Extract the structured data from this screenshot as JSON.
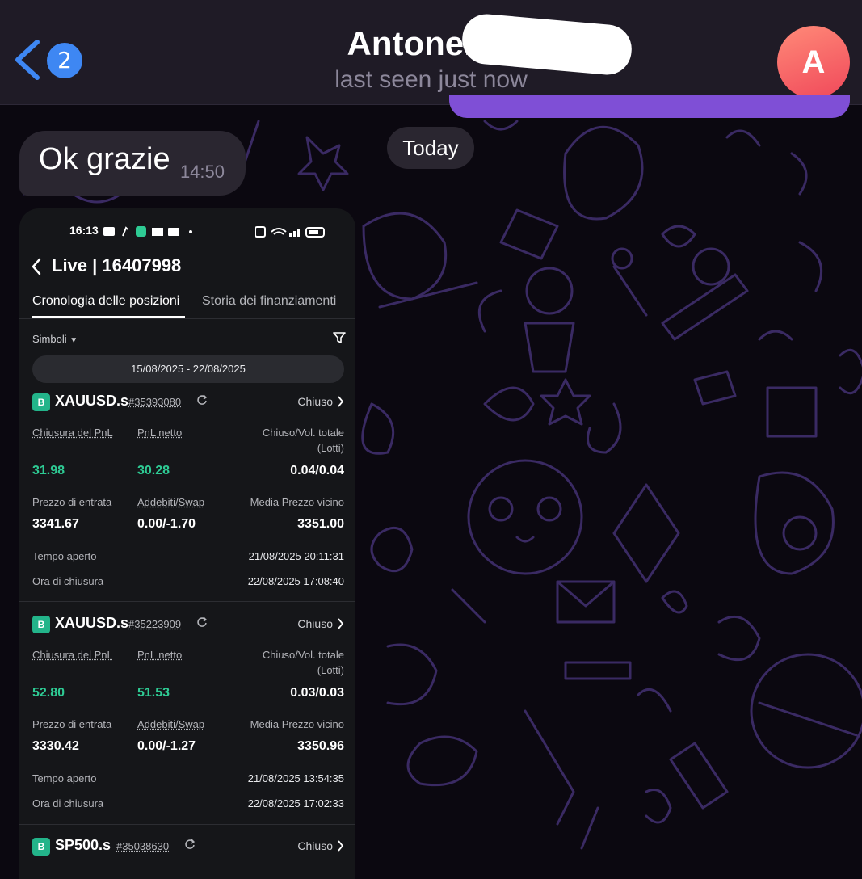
{
  "header": {
    "back_badge": "2",
    "contact_name": "Antonella M",
    "status": "last seen just now",
    "avatar_letter": "A"
  },
  "chat": {
    "date_chip": "Today",
    "message": {
      "text": "Ok grazie",
      "time": "14:50"
    }
  },
  "screenshot": {
    "statusbar": {
      "time": "16:13"
    },
    "title": "Live | 16407998",
    "tabs": [
      "Cronologia delle posizioni",
      "Storia dei finanziamenti"
    ],
    "filter_label": "Simboli",
    "date_range": "15/08/2025 - 22/08/2025",
    "labels": {
      "closing_pnl": "Chiusura del PnL",
      "net_pnl": "PnL netto",
      "closed_volume": "Chiuso/Vol. totale",
      "lots": "(Lotti)",
      "entry_price": "Prezzo di entrata",
      "charges_swap": "Addebiti/Swap",
      "avg_close_price": "Media Prezzo vicino",
      "open_time": "Tempo aperto",
      "close_time": "Ora di chiusura"
    },
    "positions": [
      {
        "side": "B",
        "symbol": "XAUUSD.s",
        "id": "#35393080",
        "status": "Chiuso",
        "closing_pnl": "31.98",
        "net_pnl": "30.28",
        "volume": "0.04/0.04",
        "entry_price": "3341.67",
        "charges_swap": "0.00/-1.70",
        "avg_close": "3351.00",
        "open_time": "21/08/2025 20:11:31",
        "close_time": "22/08/2025 17:08:40"
      },
      {
        "side": "B",
        "symbol": "XAUUSD.s",
        "id": "#35223909",
        "status": "Chiuso",
        "closing_pnl": "52.80",
        "net_pnl": "51.53",
        "volume": "0.03/0.03",
        "entry_price": "3330.42",
        "charges_swap": "0.00/-1.27",
        "avg_close": "3350.96",
        "open_time": "21/08/2025 13:54:35",
        "close_time": "22/08/2025 17:02:33"
      },
      {
        "side": "B",
        "symbol": "SP500.s",
        "id": "#35038630",
        "status": "Chiuso"
      }
    ]
  },
  "colors": {
    "accent_purple": "#7f4fd6",
    "badge_blue": "#3e87f3",
    "profit_green": "#2ecb94",
    "buy_badge": "#23b48a"
  }
}
